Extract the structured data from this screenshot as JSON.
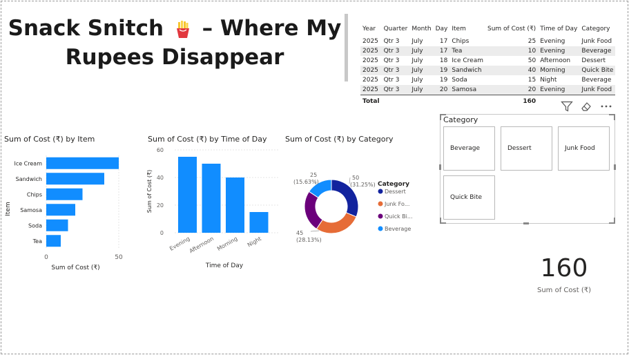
{
  "title": {
    "line1_prefix": "Snack Snitch",
    "line1_suffix": "– Where My",
    "line2": "Rupees Disappear"
  },
  "table": {
    "columns": [
      "Year",
      "Quarter",
      "Month",
      "Day",
      "Item",
      "Sum of Cost (₹)",
      "Time of Day",
      "Category"
    ],
    "rows": [
      [
        "2025",
        "Qtr 3",
        "July",
        "17",
        "Chips",
        "25",
        "Evening",
        "Junk Food"
      ],
      [
        "2025",
        "Qtr 3",
        "July",
        "17",
        "Tea",
        "10",
        "Evening",
        "Beverage"
      ],
      [
        "2025",
        "Qtr 3",
        "July",
        "18",
        "Ice Cream",
        "50",
        "Afternoon",
        "Dessert"
      ],
      [
        "2025",
        "Qtr 3",
        "July",
        "19",
        "Sandwich",
        "40",
        "Morning",
        "Quick Bite"
      ],
      [
        "2025",
        "Qtr 3",
        "July",
        "19",
        "Soda",
        "15",
        "Night",
        "Beverage"
      ],
      [
        "2025",
        "Qtr 3",
        "July",
        "20",
        "Samosa",
        "20",
        "Evening",
        "Junk Food"
      ]
    ],
    "total_label": "Total",
    "total_value": "160"
  },
  "toolbar": {
    "filter_icon": "filter-icon",
    "eraser_icon": "eraser-icon",
    "more_icon": "more-options-icon"
  },
  "slicer": {
    "title": "Category",
    "options": [
      "Beverage",
      "Dessert",
      "Junk Food",
      "Quick Bite"
    ]
  },
  "card": {
    "value": "160",
    "label": "Sum of Cost (₹)"
  },
  "colors": {
    "bar": "#118DFF",
    "dessert": "#12239E",
    "junk_food": "#E66C37",
    "quick_bite": "#6B007B",
    "beverage": "#118DFF"
  },
  "chart_data": [
    {
      "type": "bar",
      "orientation": "horizontal",
      "title": "Sum of Cost (₹) by Item",
      "categories": [
        "Ice Cream",
        "Sandwich",
        "Chips",
        "Samosa",
        "Soda",
        "Tea"
      ],
      "values": [
        50,
        40,
        25,
        20,
        15,
        10
      ],
      "xlabel": "Sum of Cost (₹)",
      "ylabel": "Item",
      "xlim": [
        0,
        50
      ],
      "xticks": [
        "0",
        "50"
      ],
      "grid": true
    },
    {
      "type": "bar",
      "title": "Sum of Cost (₹) by Time of Day",
      "categories": [
        "Evening",
        "Afternoon",
        "Morning",
        "Night"
      ],
      "values": [
        55,
        50,
        40,
        15
      ],
      "xlabel": "Time of Day",
      "ylabel": "Sum of Cost (₹)",
      "ylim": [
        0,
        60
      ],
      "yticks": [
        "0",
        "20",
        "40",
        "60"
      ],
      "grid": true
    },
    {
      "type": "pie",
      "donut": true,
      "title": "Sum of Cost (₹) by Category",
      "legend_title": "Category",
      "legend_position": "right",
      "series": [
        {
          "name": "Dessert",
          "legend_label": "Dessert",
          "value": 50,
          "data_label": "50",
          "data_pct": "(31.25%)"
        },
        {
          "name": "Junk Food",
          "legend_label": "Junk Fo...",
          "value": 45,
          "data_label": "45",
          "data_pct": "(28.13%)"
        },
        {
          "name": "Quick Bite",
          "legend_label": "Quick Bi...",
          "value": 40,
          "data_label": "",
          "data_pct": ""
        },
        {
          "name": "Beverage",
          "legend_label": "Beverage",
          "value": 25,
          "data_label": "25",
          "data_pct": "(15.63%)"
        }
      ]
    }
  ]
}
